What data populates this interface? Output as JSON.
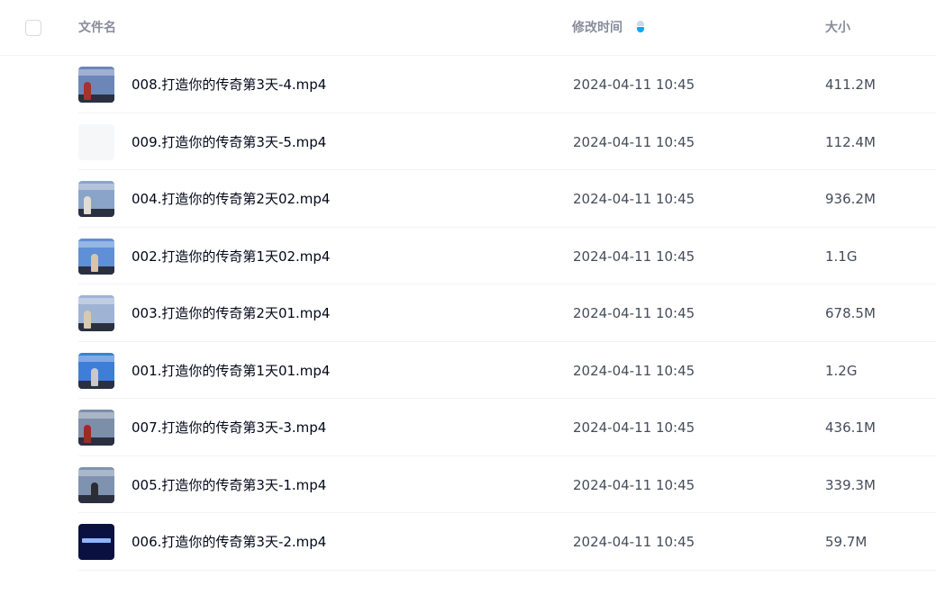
{
  "header": {
    "name_label": "文件名",
    "time_label": "修改时间",
    "size_label": "大小",
    "sort_active_color": "#06a7ff"
  },
  "rows": [
    {
      "name": "008.打造你的传奇第3天-4.mp4",
      "modified": "2024-04-11 10:45",
      "size": "411.2M",
      "thumb_bg": "#6d86b8",
      "person_color": "#a8312c"
    },
    {
      "name": "009.打造你的传奇第3天-5.mp4",
      "modified": "2024-04-11 10:45",
      "size": "112.4M",
      "thumb_bg": "#f6f7f9",
      "person_color": ""
    },
    {
      "name": "004.打造你的传奇第2天02.mp4",
      "modified": "2024-04-11 10:45",
      "size": "936.2M",
      "thumb_bg": "#8aa3c9",
      "person_color": "#e2dcd2"
    },
    {
      "name": "002.打造你的传奇第1天02.mp4",
      "modified": "2024-04-11 10:45",
      "size": "1.1G",
      "thumb_bg": "#5f8fd6",
      "person_color": "#d8c4a8"
    },
    {
      "name": "003.打造你的传奇第2天01.mp4",
      "modified": "2024-04-11 10:45",
      "size": "678.5M",
      "thumb_bg": "#9fb4d4",
      "person_color": "#d9c9ae"
    },
    {
      "name": "001.打造你的传奇第1天01.mp4",
      "modified": "2024-04-11 10:45",
      "size": "1.2G",
      "thumb_bg": "#3d7fd8",
      "person_color": "#c9c9cc"
    },
    {
      "name": "007.打造你的传奇第3天-3.mp4",
      "modified": "2024-04-11 10:45",
      "size": "436.1M",
      "thumb_bg": "#7d8ea8",
      "person_color": "#9e2a26"
    },
    {
      "name": "005.打造你的传奇第3天-1.mp4",
      "modified": "2024-04-11 10:45",
      "size": "339.3M",
      "thumb_bg": "#7f93b0",
      "person_color": "#2a2d33"
    },
    {
      "name": "006.打造你的传奇第3天-2.mp4",
      "modified": "2024-04-11 10:45",
      "size": "59.7M",
      "thumb_bg": "#0a1140",
      "person_color": ""
    }
  ]
}
